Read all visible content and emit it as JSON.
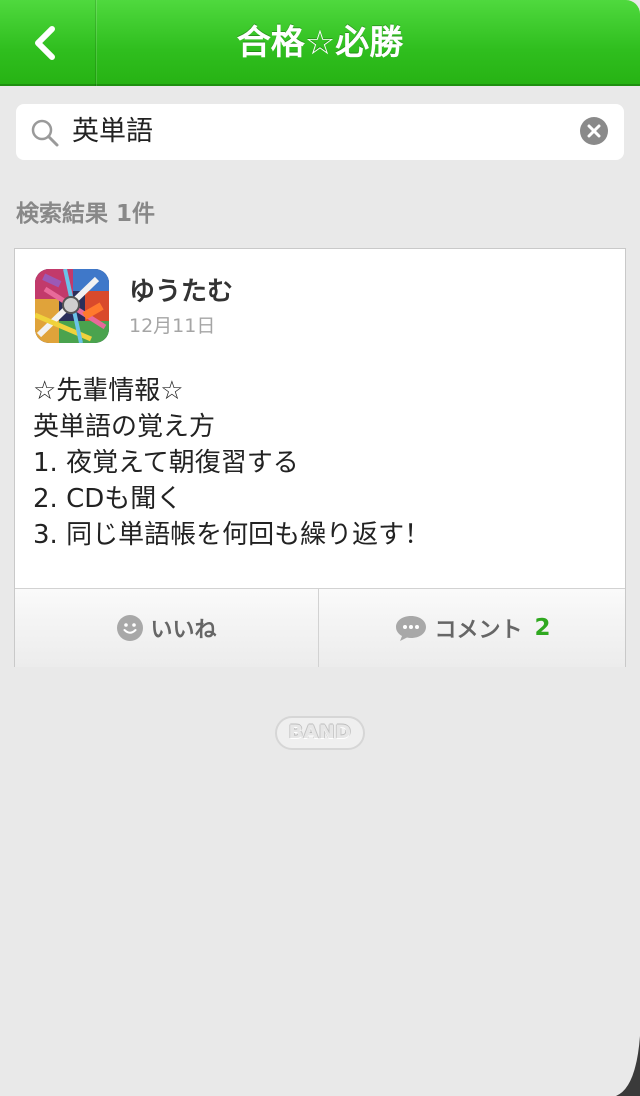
{
  "header": {
    "title": "合格☆必勝",
    "back_icon": "chevron-left-icon"
  },
  "search": {
    "query": "英単語",
    "search_icon": "search-icon",
    "clear_icon": "clear-icon"
  },
  "results": {
    "count_label": "検索結果 1件"
  },
  "post": {
    "author": "ゆうたむ",
    "date": "12月11日",
    "body_lines": [
      "☆先輩情報☆",
      "英単語の覚え方",
      "1. 夜覚えて朝復習する",
      "2. CDも聞く",
      "3. 同じ単語帳を何回も繰り返す！"
    ],
    "like_label": "いいね",
    "comment_label": "コメント",
    "comment_count": "2"
  },
  "footer": {
    "logo_text": "BAND"
  },
  "colors": {
    "header_green": "#2fbe1e",
    "comment_count_green": "#2fa81f",
    "background": "#e9e9e9"
  }
}
